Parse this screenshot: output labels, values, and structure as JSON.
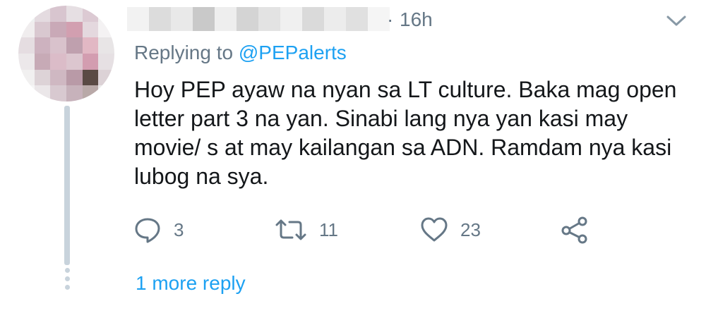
{
  "tweet": {
    "timestamp": "16h",
    "separator": "·",
    "replying_prefix": "Replying to ",
    "replying_handle": "@PEPalerts",
    "text": "Hoy PEP ayaw na nyan sa LT culture. Baka mag open letter part 3 na yan. Sinabi lang nya yan kasi may movie/ s at may kailangan sa ADN. Ramdam nya kasi lubog na sya.",
    "actions": {
      "reply_count": "3",
      "retweet_count": "11",
      "like_count": "23"
    },
    "more_replies_label": "1 more reply"
  },
  "icons": {
    "reply": "reply-icon",
    "retweet": "retweet-icon",
    "like": "heart-icon",
    "share": "share-icon",
    "menu": "chevron-down-icon"
  },
  "colors": {
    "accent": "#1da1f2",
    "secondary_text": "#657786",
    "primary_text": "#14171a",
    "thread_line": "#c8d3dc"
  }
}
